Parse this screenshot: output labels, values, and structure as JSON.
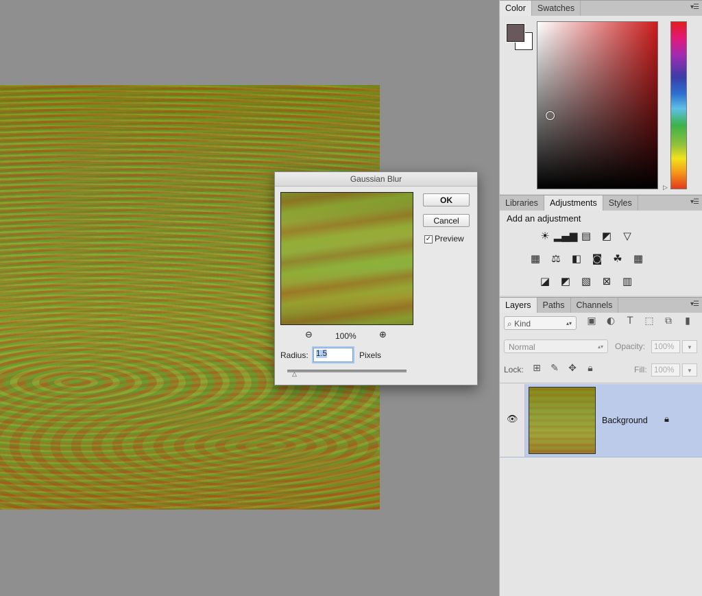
{
  "color_panel": {
    "tabs": [
      "Color",
      "Swatches"
    ],
    "active_tab": "Color",
    "foreground_color": "#69595c",
    "background_color": "#ffffff",
    "picker_hue_color": "#cc1c1c"
  },
  "adjustments_panel": {
    "tabs": [
      "Libraries",
      "Adjustments",
      "Styles"
    ],
    "active_tab": "Adjustments",
    "title": "Add an adjustment",
    "icons_row1": [
      "brightness-contrast-icon",
      "levels-icon",
      "curves-icon",
      "exposure-icon",
      "vibrance-icon"
    ],
    "icons_row2": [
      "hue-saturation-icon",
      "color-balance-icon",
      "black-white-icon",
      "photo-filter-icon",
      "channel-mixer-icon",
      "color-lookup-icon"
    ],
    "icons_row3": [
      "invert-icon",
      "posterize-icon",
      "threshold-icon",
      "selective-color-icon",
      "gradient-map-icon"
    ]
  },
  "layers_panel": {
    "tabs": [
      "Layers",
      "Paths",
      "Channels"
    ],
    "active_tab": "Layers",
    "filter_kind": "Kind",
    "blend_mode": "Normal",
    "opacity_label": "Opacity:",
    "opacity_value": "100%",
    "lock_label": "Lock:",
    "fill_label": "Fill:",
    "fill_value": "100%",
    "layers": [
      {
        "name": "Background",
        "visible": true,
        "locked": true
      }
    ]
  },
  "gaussian_blur_dialog": {
    "title": "Gaussian Blur",
    "ok_label": "OK",
    "cancel_label": "Cancel",
    "preview_label": "Preview",
    "preview_checked": true,
    "zoom_level": "100%",
    "radius_label": "Radius:",
    "radius_value": "1.5",
    "radius_units": "Pixels"
  }
}
